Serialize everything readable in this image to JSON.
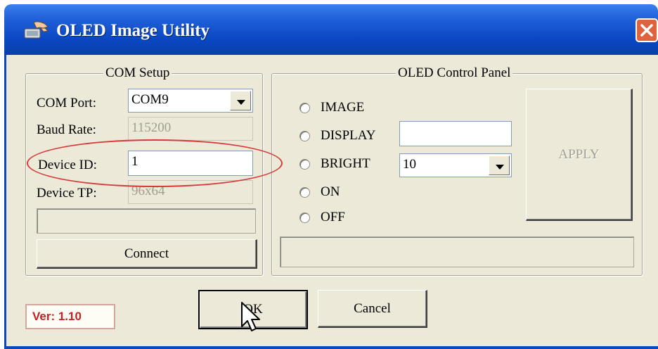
{
  "window": {
    "title": "OLED Image Utility",
    "title_icon": "app-hand-icon",
    "close_icon": "close-icon"
  },
  "com_setup": {
    "title": "COM Setup",
    "com_port_label": "COM Port:",
    "com_port_value": "COM9",
    "baud_rate_label": "Baud Rate:",
    "baud_rate_value": "115200",
    "device_id_label": "Device ID:",
    "device_id_value": "1",
    "device_tp_label": "Device TP:",
    "device_tp_value": "96x64",
    "status_text": "",
    "connect_label": "Connect"
  },
  "oled_panel": {
    "title": "OLED Control Panel",
    "options": [
      "IMAGE",
      "DISPLAY",
      "BRIGHT",
      "ON",
      "OFF"
    ],
    "display_text": "",
    "bright_value": "10",
    "apply_label": "APPLY",
    "status_text": ""
  },
  "footer": {
    "version": "Ver: 1.10",
    "ok_label": "OK",
    "cancel_label": "Cancel"
  },
  "colors": {
    "titlebar": "#0b47c0",
    "dialog_bg": "#ece9d8",
    "annotation_ellipse": "#d53a3a",
    "version_text": "#c62020"
  }
}
